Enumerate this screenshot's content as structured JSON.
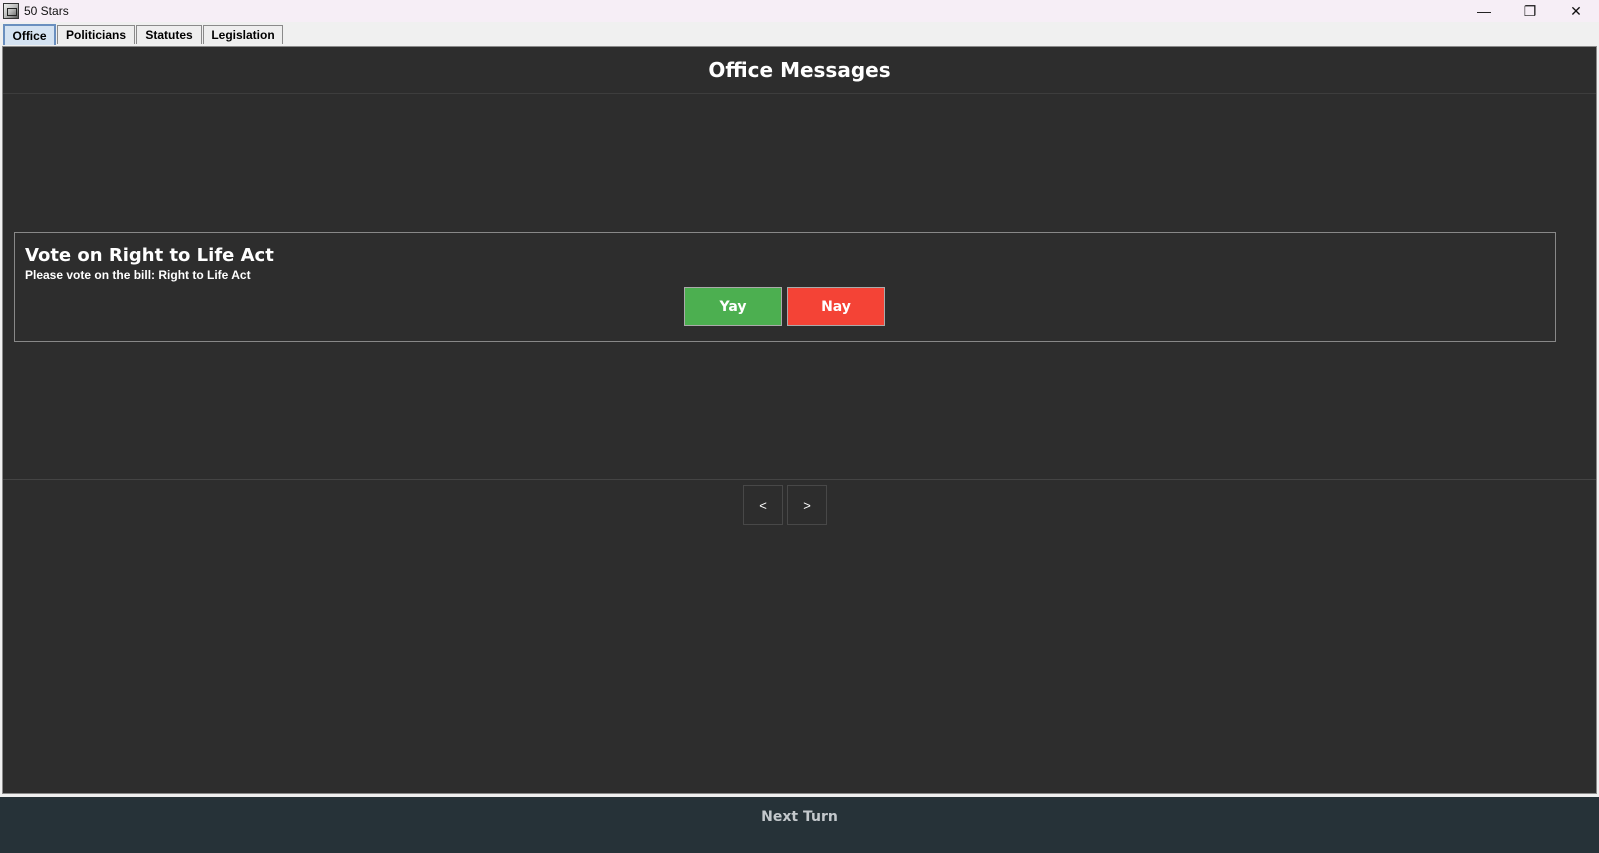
{
  "window": {
    "title": "50 Stars",
    "minimize": "—",
    "restore": "❐",
    "close": "✕"
  },
  "tabs": [
    {
      "label": "Office",
      "active": true
    },
    {
      "label": "Politicians",
      "active": false
    },
    {
      "label": "Statutes",
      "active": false
    },
    {
      "label": "Legislation",
      "active": false
    }
  ],
  "main": {
    "title": "Office Messages",
    "message": {
      "title": "Vote on Right to Life Act",
      "body": "Please vote on the bill: Right to Life Act",
      "yay_label": "Yay",
      "nay_label": "Nay"
    },
    "nav": {
      "prev_label": "<",
      "next_label": ">"
    }
  },
  "footer": {
    "next_turn_label": "Next Turn"
  },
  "colors": {
    "background": "#2d2d2d",
    "yay": "#4caf50",
    "nay": "#f44336",
    "footer": "#263238"
  }
}
